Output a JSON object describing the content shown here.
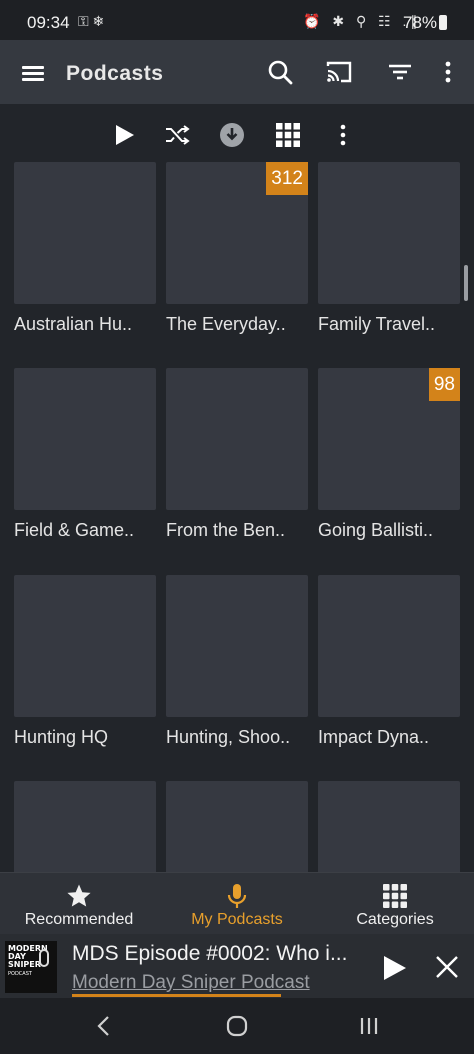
{
  "status_bar": {
    "time": "09:34",
    "left_icons": "⚿ ❄",
    "right_icons": "⏰ ✱ ⚲ ☷ .∥",
    "battery": "78%"
  },
  "app_bar": {
    "title": "Podcasts",
    "icons": [
      "menu-icon",
      "search-icon",
      "cast-icon",
      "filter-icon",
      "more-vert-icon"
    ]
  },
  "toolbar": {
    "icons": [
      "play-icon",
      "shuffle-icon",
      "download-icon",
      "grid-view-icon",
      "more-vert-icon"
    ]
  },
  "podcasts": [
    {
      "label": "Australian Hu..",
      "badge": ""
    },
    {
      "label": "The Everyday..",
      "badge": "312"
    },
    {
      "label": "Family Travel..",
      "badge": ""
    },
    {
      "label": "Field & Game..",
      "badge": ""
    },
    {
      "label": "From the Ben..",
      "badge": ""
    },
    {
      "label": "Going Ballisti..",
      "badge": "98"
    },
    {
      "label": "Hunting HQ",
      "badge": ""
    },
    {
      "label": "Hunting, Shoo..",
      "badge": ""
    },
    {
      "label": "Impact Dyna..",
      "badge": ""
    },
    {
      "label": "",
      "badge": ""
    },
    {
      "label": "",
      "badge": ""
    },
    {
      "label": "",
      "badge": ""
    }
  ],
  "bottom_nav": {
    "items": [
      {
        "label": "Recommended",
        "icon": "star-icon",
        "active": false
      },
      {
        "label": "My Podcasts",
        "icon": "microphone-icon",
        "active": true
      },
      {
        "label": "Categories",
        "icon": "grid-icon",
        "active": false
      }
    ]
  },
  "player": {
    "art_text": "MODERN\nDAY\nSNIPER\nPODCAST",
    "title": "MDS Episode #0002: Who i...",
    "podcast": "Modern Day Sniper Podcast",
    "progress": 0.72
  },
  "colors": {
    "accent": "#d3831a",
    "background": "#22252a",
    "app_bar": "#353940",
    "tile": "#363941"
  }
}
